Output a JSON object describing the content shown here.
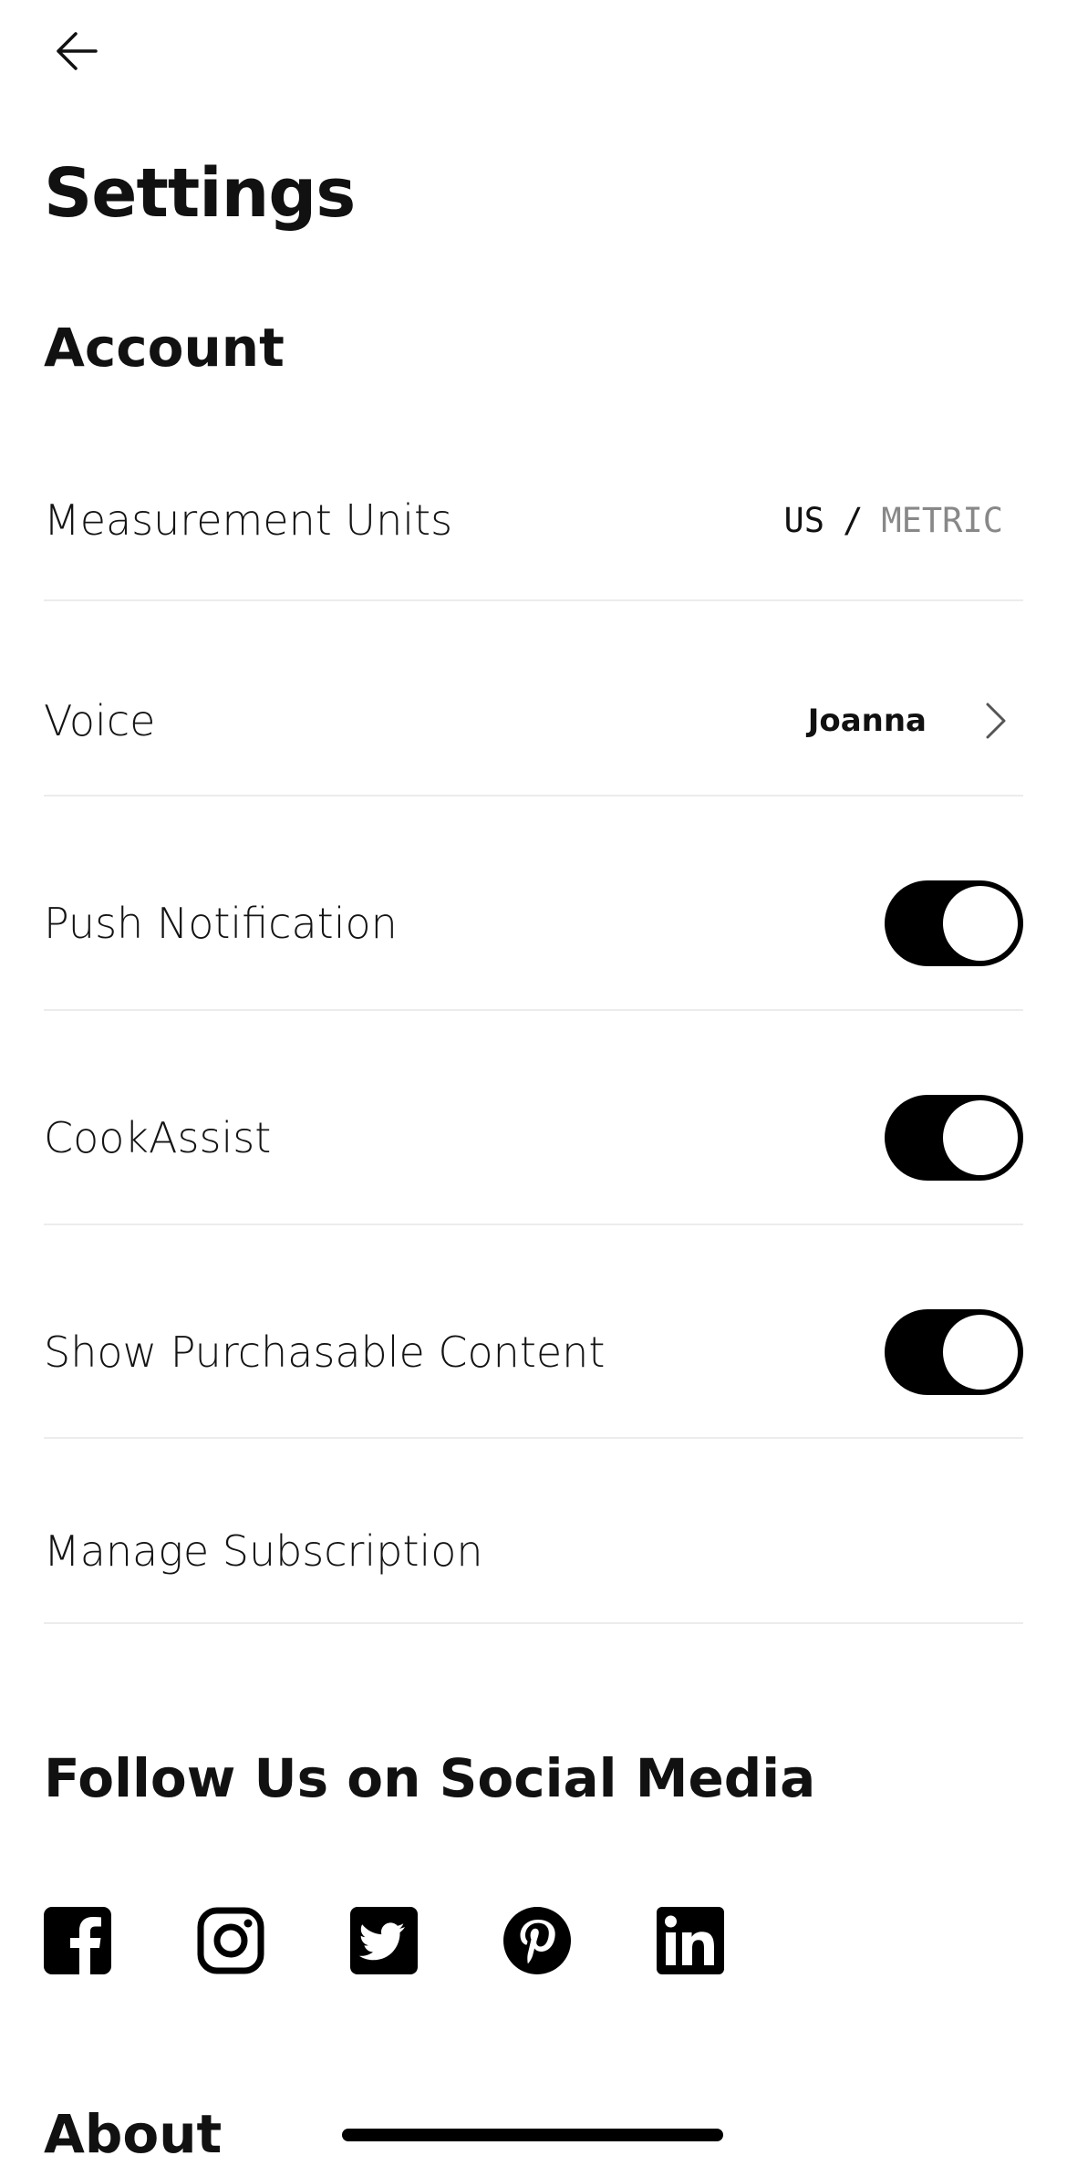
{
  "header": {
    "back_icon": "arrow-left-icon",
    "title": "Settings"
  },
  "account": {
    "title": "Account",
    "measurement_units": {
      "label": "Measurement Units",
      "option_us": "US",
      "separator": "/",
      "option_metric": "METRIC",
      "selected": "US"
    },
    "voice": {
      "label": "Voice",
      "value": "Joanna",
      "icon": "chevron-right-icon"
    },
    "push_notification": {
      "label": "Push Notification",
      "enabled": true
    },
    "cook_assist": {
      "label": "CookAssist",
      "enabled": true
    },
    "show_purchasable": {
      "label": "Show Purchasable Content",
      "enabled": true
    },
    "manage_subscription": {
      "label": "Manage Subscription"
    }
  },
  "social": {
    "title": "Follow Us on Social Media",
    "icons": [
      "facebook-icon",
      "instagram-icon",
      "twitter-icon",
      "pinterest-icon",
      "linkedin-icon"
    ]
  },
  "about": {
    "title": "About"
  },
  "colors": {
    "toggle_on": "#000000",
    "divider": "#ececec",
    "inactive_unit": "#888888"
  }
}
